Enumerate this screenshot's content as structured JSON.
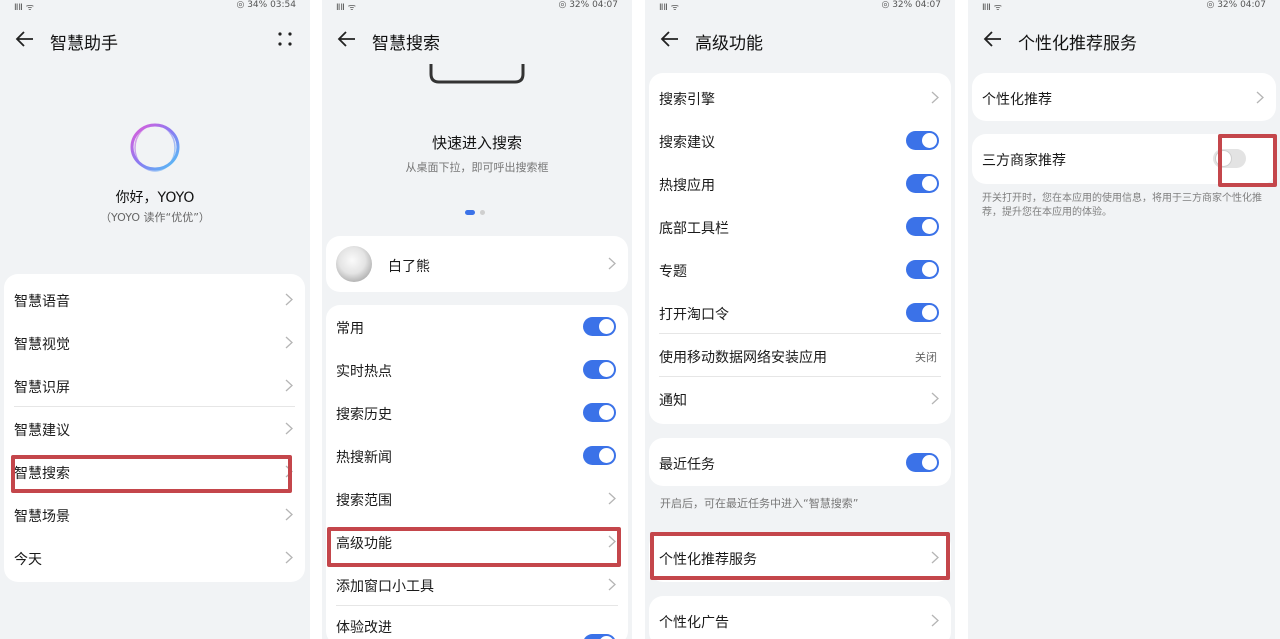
{
  "panel1": {
    "status": {
      "left": "ⅡⅡ ᯤ",
      "right": "◎ 34% 03:54"
    },
    "title": "智慧助手",
    "greeting": "你好，YOYO",
    "reading": "（YOYO 读作“优优”）",
    "items": [
      {
        "label": "智慧语音"
      },
      {
        "label": "智慧视觉"
      },
      {
        "label": "智慧识屏"
      },
      {
        "label": "智慧建议"
      },
      {
        "label": "智慧搜索"
      },
      {
        "label": "智慧场景"
      },
      {
        "label": "今天"
      }
    ]
  },
  "panel2": {
    "status": {
      "left": "ⅡⅡ ᯤ",
      "right": "◎ 32% 04:07"
    },
    "title": "智慧搜索",
    "promo_title": "快速进入搜索",
    "promo_sub": "从桌面下拉，即可呼出搜索框",
    "account": "白了熊",
    "items": [
      {
        "label": "常用",
        "toggle": true
      },
      {
        "label": "实时热点",
        "toggle": true
      },
      {
        "label": "搜索历史",
        "toggle": true
      },
      {
        "label": "热搜新闻",
        "toggle": true
      },
      {
        "label": "搜索范围"
      },
      {
        "label": "高级功能"
      },
      {
        "label": "添加窗口小工具"
      },
      {
        "label": "体验改进",
        "toggle": true
      }
    ]
  },
  "panel3": {
    "status": {
      "left": "ⅡⅡ ᯤ",
      "right": "◎ 32% 04:07"
    },
    "title": "高级功能",
    "items": [
      {
        "label": "搜索引擎"
      },
      {
        "label": "搜索建议",
        "toggle": true
      },
      {
        "label": "热搜应用",
        "toggle": true
      },
      {
        "label": "底部工具栏",
        "toggle": true
      },
      {
        "label": "专题",
        "toggle": true
      },
      {
        "label": "打开淘口令",
        "toggle": true
      },
      {
        "label": "使用移动数据网络安装应用",
        "state": "关闭"
      },
      {
        "label": "通知"
      }
    ],
    "recent_task": "最近任务",
    "recent_note": "开启后，可在最近任务中进入“智慧搜索”",
    "personal_service": "个性化推荐服务",
    "personal_ads": "个性化广告"
  },
  "panel4": {
    "status": {
      "left": "ⅡⅡ ᯤ",
      "right": "◎ 32% 04:07"
    },
    "title": "个性化推荐服务",
    "personal_rec": "个性化推荐",
    "third_party": "三方商家推荐",
    "note": "开关打开时，您在本应用的使用信息，将用于三方商家个性化推荐，提升您在本应用的体验。"
  },
  "colors": {
    "accent": "#3b72e8",
    "highlight": "#c4464b",
    "background": "#f1f3f5"
  },
  "icons": [
    "back-arrow-icon",
    "more-dots-icon",
    "chevron-right-icon",
    "yoyo-orb-icon",
    "avatar"
  ]
}
